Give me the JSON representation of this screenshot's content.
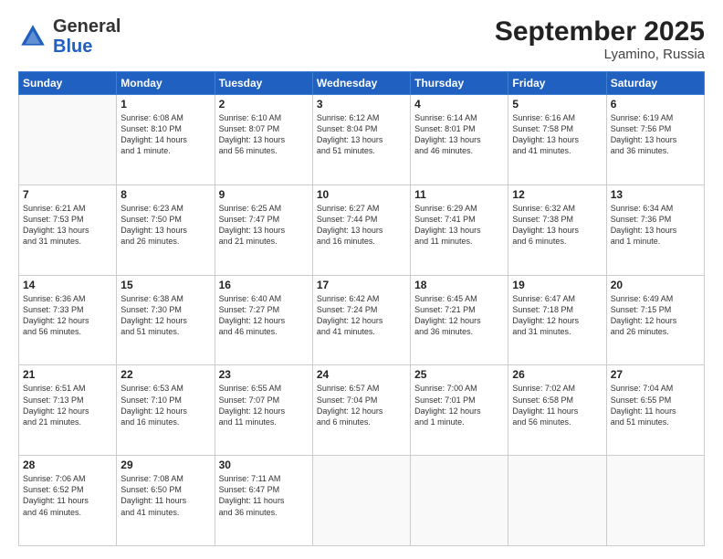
{
  "header": {
    "logo_general": "General",
    "logo_blue": "Blue",
    "month_title": "September 2025",
    "location": "Lyamino, Russia"
  },
  "days_of_week": [
    "Sunday",
    "Monday",
    "Tuesday",
    "Wednesday",
    "Thursday",
    "Friday",
    "Saturday"
  ],
  "weeks": [
    [
      {
        "day": "",
        "info": ""
      },
      {
        "day": "1",
        "info": "Sunrise: 6:08 AM\nSunset: 8:10 PM\nDaylight: 14 hours\nand 1 minute."
      },
      {
        "day": "2",
        "info": "Sunrise: 6:10 AM\nSunset: 8:07 PM\nDaylight: 13 hours\nand 56 minutes."
      },
      {
        "day": "3",
        "info": "Sunrise: 6:12 AM\nSunset: 8:04 PM\nDaylight: 13 hours\nand 51 minutes."
      },
      {
        "day": "4",
        "info": "Sunrise: 6:14 AM\nSunset: 8:01 PM\nDaylight: 13 hours\nand 46 minutes."
      },
      {
        "day": "5",
        "info": "Sunrise: 6:16 AM\nSunset: 7:58 PM\nDaylight: 13 hours\nand 41 minutes."
      },
      {
        "day": "6",
        "info": "Sunrise: 6:19 AM\nSunset: 7:56 PM\nDaylight: 13 hours\nand 36 minutes."
      }
    ],
    [
      {
        "day": "7",
        "info": "Sunrise: 6:21 AM\nSunset: 7:53 PM\nDaylight: 13 hours\nand 31 minutes."
      },
      {
        "day": "8",
        "info": "Sunrise: 6:23 AM\nSunset: 7:50 PM\nDaylight: 13 hours\nand 26 minutes."
      },
      {
        "day": "9",
        "info": "Sunrise: 6:25 AM\nSunset: 7:47 PM\nDaylight: 13 hours\nand 21 minutes."
      },
      {
        "day": "10",
        "info": "Sunrise: 6:27 AM\nSunset: 7:44 PM\nDaylight: 13 hours\nand 16 minutes."
      },
      {
        "day": "11",
        "info": "Sunrise: 6:29 AM\nSunset: 7:41 PM\nDaylight: 13 hours\nand 11 minutes."
      },
      {
        "day": "12",
        "info": "Sunrise: 6:32 AM\nSunset: 7:38 PM\nDaylight: 13 hours\nand 6 minutes."
      },
      {
        "day": "13",
        "info": "Sunrise: 6:34 AM\nSunset: 7:36 PM\nDaylight: 13 hours\nand 1 minute."
      }
    ],
    [
      {
        "day": "14",
        "info": "Sunrise: 6:36 AM\nSunset: 7:33 PM\nDaylight: 12 hours\nand 56 minutes."
      },
      {
        "day": "15",
        "info": "Sunrise: 6:38 AM\nSunset: 7:30 PM\nDaylight: 12 hours\nand 51 minutes."
      },
      {
        "day": "16",
        "info": "Sunrise: 6:40 AM\nSunset: 7:27 PM\nDaylight: 12 hours\nand 46 minutes."
      },
      {
        "day": "17",
        "info": "Sunrise: 6:42 AM\nSunset: 7:24 PM\nDaylight: 12 hours\nand 41 minutes."
      },
      {
        "day": "18",
        "info": "Sunrise: 6:45 AM\nSunset: 7:21 PM\nDaylight: 12 hours\nand 36 minutes."
      },
      {
        "day": "19",
        "info": "Sunrise: 6:47 AM\nSunset: 7:18 PM\nDaylight: 12 hours\nand 31 minutes."
      },
      {
        "day": "20",
        "info": "Sunrise: 6:49 AM\nSunset: 7:15 PM\nDaylight: 12 hours\nand 26 minutes."
      }
    ],
    [
      {
        "day": "21",
        "info": "Sunrise: 6:51 AM\nSunset: 7:13 PM\nDaylight: 12 hours\nand 21 minutes."
      },
      {
        "day": "22",
        "info": "Sunrise: 6:53 AM\nSunset: 7:10 PM\nDaylight: 12 hours\nand 16 minutes."
      },
      {
        "day": "23",
        "info": "Sunrise: 6:55 AM\nSunset: 7:07 PM\nDaylight: 12 hours\nand 11 minutes."
      },
      {
        "day": "24",
        "info": "Sunrise: 6:57 AM\nSunset: 7:04 PM\nDaylight: 12 hours\nand 6 minutes."
      },
      {
        "day": "25",
        "info": "Sunrise: 7:00 AM\nSunset: 7:01 PM\nDaylight: 12 hours\nand 1 minute."
      },
      {
        "day": "26",
        "info": "Sunrise: 7:02 AM\nSunset: 6:58 PM\nDaylight: 11 hours\nand 56 minutes."
      },
      {
        "day": "27",
        "info": "Sunrise: 7:04 AM\nSunset: 6:55 PM\nDaylight: 11 hours\nand 51 minutes."
      }
    ],
    [
      {
        "day": "28",
        "info": "Sunrise: 7:06 AM\nSunset: 6:52 PM\nDaylight: 11 hours\nand 46 minutes."
      },
      {
        "day": "29",
        "info": "Sunrise: 7:08 AM\nSunset: 6:50 PM\nDaylight: 11 hours\nand 41 minutes."
      },
      {
        "day": "30",
        "info": "Sunrise: 7:11 AM\nSunset: 6:47 PM\nDaylight: 11 hours\nand 36 minutes."
      },
      {
        "day": "",
        "info": ""
      },
      {
        "day": "",
        "info": ""
      },
      {
        "day": "",
        "info": ""
      },
      {
        "day": "",
        "info": ""
      }
    ]
  ]
}
